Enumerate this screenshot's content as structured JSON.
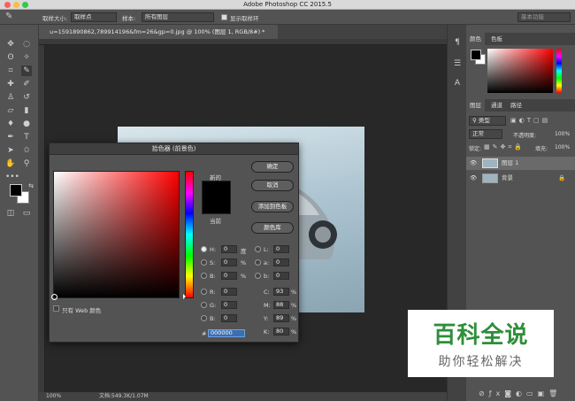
{
  "window": {
    "title": "Adobe Photoshop CC 2015.5"
  },
  "options": {
    "sample_size_label": "取样大小:",
    "sample_size_value": "取样点",
    "sample_label": "样本:",
    "sample_value": "所有图层",
    "show_ring_label": "显示取样环",
    "workspace": "基本功能"
  },
  "document": {
    "tab_title": "u=1591890862,789914196&fm=26&gp=0.jpg @ 100% (图层 1, RGB/8#) *",
    "zoom": "100%",
    "doc_info": "文档:549.3K/1.07M"
  },
  "color_panel": {
    "tab_color": "颜色",
    "tab_swatches": "色板"
  },
  "layers_panel": {
    "tab_layers": "图层",
    "tab_channels": "通道",
    "tab_paths": "路径",
    "filter_kind": "类型",
    "blend_mode": "正常",
    "opacity_label": "不透明度:",
    "opacity_value": "100%",
    "lock_label": "锁定:",
    "fill_label": "填充:",
    "fill_value": "100%",
    "layers": [
      {
        "name": "图层 1"
      },
      {
        "name": "背景"
      }
    ]
  },
  "dialog": {
    "title": "拾色器 (前景色)",
    "new_label": "新的",
    "current_label": "当前",
    "ok": "确定",
    "cancel": "取消",
    "add_swatch": "添加到色板",
    "color_libraries": "颜色库",
    "web_only": "只有 Web 颜色",
    "H": {
      "label": "H:",
      "value": "0",
      "unit": "度"
    },
    "S": {
      "label": "S:",
      "value": "0",
      "unit": "%"
    },
    "Bv": {
      "label": "B:",
      "value": "0",
      "unit": "%"
    },
    "R": {
      "label": "R:",
      "value": "0"
    },
    "G": {
      "label": "G:",
      "value": "0"
    },
    "B": {
      "label": "B:",
      "value": "0"
    },
    "L": {
      "label": "L:",
      "value": "0"
    },
    "a": {
      "label": "a:",
      "value": "0"
    },
    "b": {
      "label": "b:",
      "value": "0"
    },
    "C": {
      "label": "C:",
      "value": "93",
      "unit": "%"
    },
    "M": {
      "label": "M:",
      "value": "88",
      "unit": "%"
    },
    "Y": {
      "label": "Y:",
      "value": "89",
      "unit": "%"
    },
    "K": {
      "label": "K:",
      "value": "80",
      "unit": "%"
    },
    "hex_label": "#",
    "hex": "000000"
  },
  "watermark": {
    "title": "百科全说",
    "subtitle": "助你轻松解决"
  }
}
